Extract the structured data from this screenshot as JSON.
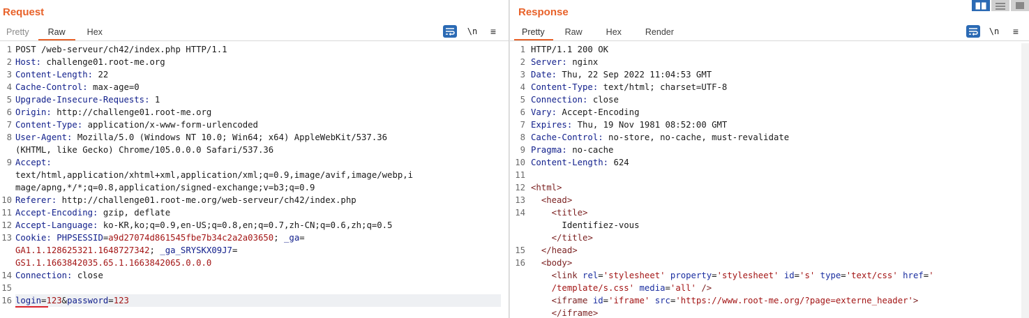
{
  "request": {
    "title": "Request",
    "tabs": [
      "Pretty",
      "Raw",
      "Hex"
    ],
    "active_tab": "Raw",
    "tools": {
      "wrap_icon": "text-wrap-icon",
      "newline_label": "\\n",
      "menu_icon": "hamburger-menu-icon"
    },
    "lines": [
      {
        "n": "1",
        "parts": [
          {
            "t": "POST /web-serveur/ch42/index.php HTTP/1.1",
            "c": ""
          }
        ]
      },
      {
        "n": "2",
        "parts": [
          {
            "t": "Host:",
            "c": "hn"
          },
          {
            "t": " challenge01.root-me.org",
            "c": ""
          }
        ]
      },
      {
        "n": "3",
        "parts": [
          {
            "t": "Content-Length:",
            "c": "hn"
          },
          {
            "t": " 22",
            "c": ""
          }
        ]
      },
      {
        "n": "4",
        "parts": [
          {
            "t": "Cache-Control:",
            "c": "hn"
          },
          {
            "t": " max-age=0",
            "c": ""
          }
        ]
      },
      {
        "n": "5",
        "parts": [
          {
            "t": "Upgrade-Insecure-Requests:",
            "c": "hn"
          },
          {
            "t": " 1",
            "c": ""
          }
        ]
      },
      {
        "n": "6",
        "parts": [
          {
            "t": "Origin:",
            "c": "hn"
          },
          {
            "t": " http://challenge01.root-me.org",
            "c": ""
          }
        ]
      },
      {
        "n": "7",
        "parts": [
          {
            "t": "Content-Type:",
            "c": "hn"
          },
          {
            "t": " application/x-www-form-urlencoded",
            "c": ""
          }
        ]
      },
      {
        "n": "8",
        "parts": [
          {
            "t": "User-Agent:",
            "c": "hn"
          },
          {
            "t": " Mozilla/5.0 (Windows NT 10.0; Win64; x64) AppleWebKit/537.36",
            "c": ""
          }
        ]
      },
      {
        "n": "",
        "parts": [
          {
            "t": "(KHTML, like Gecko) Chrome/105.0.0.0 Safari/537.36",
            "c": ""
          }
        ]
      },
      {
        "n": "9",
        "parts": [
          {
            "t": "Accept:",
            "c": "hn"
          }
        ]
      },
      {
        "n": "",
        "parts": [
          {
            "t": "text/html,application/xhtml+xml,application/xml;q=0.9,image/avif,image/webp,i",
            "c": ""
          }
        ]
      },
      {
        "n": "",
        "parts": [
          {
            "t": "mage/apng,*/*;q=0.8,application/signed-exchange;v=b3;q=0.9",
            "c": ""
          }
        ]
      },
      {
        "n": "10",
        "parts": [
          {
            "t": "Referer:",
            "c": "hn"
          },
          {
            "t": " http://challenge01.root-me.org/web-serveur/ch42/index.php",
            "c": ""
          }
        ]
      },
      {
        "n": "11",
        "parts": [
          {
            "t": "Accept-Encoding:",
            "c": "hn"
          },
          {
            "t": " gzip, deflate",
            "c": ""
          }
        ]
      },
      {
        "n": "12",
        "parts": [
          {
            "t": "Accept-Language:",
            "c": "hn"
          },
          {
            "t": " ko-KR,ko;q=0.9,en-US;q=0.8,en;q=0.7,zh-CN;q=0.6,zh;q=0.5",
            "c": ""
          }
        ]
      },
      {
        "n": "13",
        "parts": [
          {
            "t": "Cookie:",
            "c": "hn"
          },
          {
            "t": " PHPSESSID",
            "c": "hn"
          },
          {
            "t": "=",
            "c": ""
          },
          {
            "t": "a9d27074d861545fbe7b34c2a2a03650",
            "c": "ck"
          },
          {
            "t": "; ",
            "c": ""
          },
          {
            "t": "_ga",
            "c": "hn"
          },
          {
            "t": "=",
            "c": ""
          }
        ]
      },
      {
        "n": "",
        "parts": [
          {
            "t": "GA1.1.128625321.1648727342",
            "c": "ck"
          },
          {
            "t": "; ",
            "c": ""
          },
          {
            "t": "_ga_SRYSKX09J7",
            "c": "hn"
          },
          {
            "t": "=",
            "c": ""
          }
        ]
      },
      {
        "n": "",
        "parts": [
          {
            "t": "GS1.1.1663842035.65.1.1663842065.0.0.0",
            "c": "ck"
          }
        ]
      },
      {
        "n": "14",
        "parts": [
          {
            "t": "Connection:",
            "c": "hn"
          },
          {
            "t": " close",
            "c": ""
          }
        ]
      },
      {
        "n": "15",
        "parts": []
      },
      {
        "n": "16",
        "parts": [
          {
            "t": "login",
            "c": "hn"
          },
          {
            "t": "=",
            "c": ""
          },
          {
            "t": "123",
            "c": "ck"
          },
          {
            "t": "&",
            "c": ""
          },
          {
            "t": "password",
            "c": "hn"
          },
          {
            "t": "=",
            "c": ""
          },
          {
            "t": "123",
            "c": "ck"
          }
        ],
        "highlight": true
      }
    ]
  },
  "response": {
    "title": "Response",
    "tabs": [
      "Pretty",
      "Raw",
      "Hex",
      "Render"
    ],
    "active_tab": "Pretty",
    "tools": {
      "wrap_icon": "text-wrap-icon",
      "newline_label": "\\n",
      "menu_icon": "hamburger-menu-icon"
    },
    "lines": [
      {
        "n": "1",
        "parts": [
          {
            "t": "HTTP/1.1 200 OK",
            "c": ""
          }
        ]
      },
      {
        "n": "2",
        "parts": [
          {
            "t": "Server:",
            "c": "hn"
          },
          {
            "t": " nginx",
            "c": ""
          }
        ]
      },
      {
        "n": "3",
        "parts": [
          {
            "t": "Date:",
            "c": "hn"
          },
          {
            "t": " Thu, 22 Sep 2022 11:04:53 GMT",
            "c": ""
          }
        ]
      },
      {
        "n": "4",
        "parts": [
          {
            "t": "Content-Type:",
            "c": "hn"
          },
          {
            "t": " text/html; charset=UTF-8",
            "c": ""
          }
        ]
      },
      {
        "n": "5",
        "parts": [
          {
            "t": "Connection:",
            "c": "hn"
          },
          {
            "t": " close",
            "c": ""
          }
        ]
      },
      {
        "n": "6",
        "parts": [
          {
            "t": "Vary:",
            "c": "hn"
          },
          {
            "t": " Accept-Encoding",
            "c": ""
          }
        ]
      },
      {
        "n": "7",
        "parts": [
          {
            "t": "Expires:",
            "c": "hn"
          },
          {
            "t": " Thu, 19 Nov 1981 08:52:00 GMT",
            "c": ""
          }
        ]
      },
      {
        "n": "8",
        "parts": [
          {
            "t": "Cache-Control:",
            "c": "hn"
          },
          {
            "t": " no-store, no-cache, must-revalidate",
            "c": ""
          }
        ]
      },
      {
        "n": "9",
        "parts": [
          {
            "t": "Pragma:",
            "c": "hn"
          },
          {
            "t": " no-cache",
            "c": ""
          }
        ]
      },
      {
        "n": "10",
        "parts": [
          {
            "t": "Content-Length:",
            "c": "hn"
          },
          {
            "t": " 624",
            "c": ""
          }
        ]
      },
      {
        "n": "11",
        "parts": []
      },
      {
        "n": "12",
        "parts": [
          {
            "t": "<html>",
            "c": "tg"
          }
        ]
      },
      {
        "n": "13",
        "parts": [
          {
            "t": "  ",
            "c": ""
          },
          {
            "t": "<head>",
            "c": "tg"
          }
        ]
      },
      {
        "n": "14",
        "parts": [
          {
            "t": "    ",
            "c": ""
          },
          {
            "t": "<title>",
            "c": "tg"
          }
        ]
      },
      {
        "n": "",
        "parts": [
          {
            "t": "      Identifiez-vous",
            "c": ""
          }
        ]
      },
      {
        "n": "",
        "parts": [
          {
            "t": "    ",
            "c": ""
          },
          {
            "t": "</title>",
            "c": "tg"
          }
        ]
      },
      {
        "n": "15",
        "parts": [
          {
            "t": "  ",
            "c": ""
          },
          {
            "t": "</head>",
            "c": "tg"
          }
        ]
      },
      {
        "n": "16",
        "parts": [
          {
            "t": "  ",
            "c": ""
          },
          {
            "t": "<body>",
            "c": "tg"
          }
        ]
      },
      {
        "n": "",
        "parts": [
          {
            "t": "    ",
            "c": ""
          },
          {
            "t": "<link",
            "c": "tg"
          },
          {
            "t": " rel",
            "c": "at"
          },
          {
            "t": "=",
            "c": ""
          },
          {
            "t": "'stylesheet'",
            "c": "vl"
          },
          {
            "t": " property",
            "c": "at"
          },
          {
            "t": "=",
            "c": ""
          },
          {
            "t": "'stylesheet'",
            "c": "vl"
          },
          {
            "t": " id",
            "c": "at"
          },
          {
            "t": "=",
            "c": ""
          },
          {
            "t": "'s'",
            "c": "vl"
          },
          {
            "t": " type",
            "c": "at"
          },
          {
            "t": "=",
            "c": ""
          },
          {
            "t": "'text/css'",
            "c": "vl"
          },
          {
            "t": " href",
            "c": "at"
          },
          {
            "t": "=",
            "c": ""
          },
          {
            "t": "'",
            "c": "vl"
          }
        ]
      },
      {
        "n": "",
        "parts": [
          {
            "t": "    ",
            "c": ""
          },
          {
            "t": "/template/s.css'",
            "c": "vl"
          },
          {
            "t": " media",
            "c": "at"
          },
          {
            "t": "=",
            "c": ""
          },
          {
            "t": "'all'",
            "c": "vl"
          },
          {
            "t": " />",
            "c": "tg"
          }
        ]
      },
      {
        "n": "",
        "parts": [
          {
            "t": "    ",
            "c": ""
          },
          {
            "t": "<iframe",
            "c": "tg"
          },
          {
            "t": " id",
            "c": "at"
          },
          {
            "t": "=",
            "c": ""
          },
          {
            "t": "'iframe'",
            "c": "vl"
          },
          {
            "t": " src",
            "c": "at"
          },
          {
            "t": "=",
            "c": ""
          },
          {
            "t": "'https://www.root-me.org/?page=externe_header'",
            "c": "vl"
          },
          {
            "t": ">",
            "c": "tg"
          }
        ]
      },
      {
        "n": "",
        "parts": [
          {
            "t": "    ",
            "c": ""
          },
          {
            "t": "</iframe>",
            "c": "tg"
          }
        ]
      }
    ]
  },
  "layout_buttons": [
    {
      "icon": "side-by-side-layout-icon",
      "active": true
    },
    {
      "icon": "stacked-layout-icon",
      "active": false
    },
    {
      "icon": "tabs-layout-icon",
      "active": false
    }
  ],
  "colors": {
    "accent": "#e8622a",
    "header_name": "#12208c",
    "value": "#a31515",
    "button_blue": "#2b6ab4"
  }
}
